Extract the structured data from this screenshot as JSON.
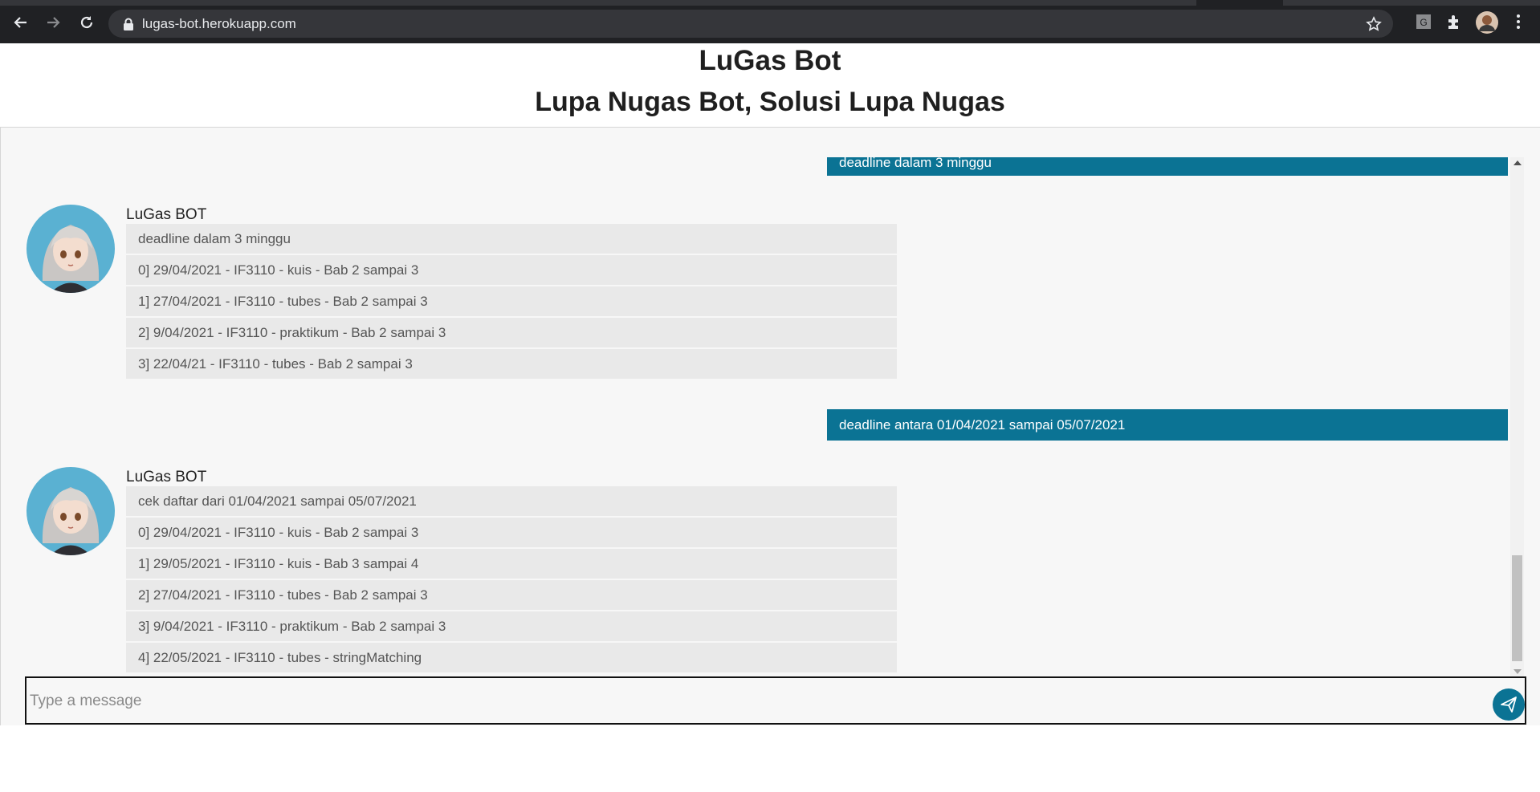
{
  "browser": {
    "url": "lugas-bot.herokuapp.com",
    "icons": [
      "back-icon",
      "forward-icon",
      "reload-icon",
      "lock-icon",
      "star-icon",
      "extension-g-icon",
      "puzzle-icon",
      "profile-avatar",
      "kebab-menu-icon"
    ]
  },
  "header": {
    "title": "LuGas Bot",
    "subtitle": "Lupa Nugas Bot, Solusi Lupa Nugas"
  },
  "chat": {
    "messages": [
      {
        "from": "user",
        "text": "deadline dalam 3 minggu"
      },
      {
        "from": "bot",
        "name": "LuGas BOT",
        "lines": [
          "deadline dalam 3 minggu",
          "0] 29/04/2021 - IF3110 - kuis - Bab 2 sampai 3",
          "1] 27/04/2021 - IF3110 - tubes - Bab 2 sampai 3",
          "2] 9/04/2021 - IF3110 - praktikum - Bab 2 sampai 3",
          "3] 22/04/21 - IF3110 - tubes - Bab 2 sampai 3"
        ]
      },
      {
        "from": "user",
        "text": "deadline antara 01/04/2021 sampai 05/07/2021"
      },
      {
        "from": "bot",
        "name": "LuGas BOT",
        "lines": [
          "cek daftar dari 01/04/2021 sampai 05/07/2021",
          "0] 29/04/2021 - IF3110 - kuis - Bab 2 sampai 3",
          "1] 29/05/2021 - IF3110 - kuis - Bab 3 sampai 4",
          "2] 27/04/2021 - IF3110 - tubes - Bab 2 sampai 3",
          "3] 9/04/2021 - IF3110 - praktikum - Bab 2 sampai 3",
          "4] 22/05/2021 - IF3110 - tubes - stringMatching"
        ]
      }
    ]
  },
  "input": {
    "placeholder": "Type a message",
    "value": ""
  },
  "colors": {
    "accent": "#0b7394",
    "bot_bubble": "#e9e9e9",
    "chat_bg": "#f7f7f7",
    "avatar_bg": "#5ab1d2"
  }
}
